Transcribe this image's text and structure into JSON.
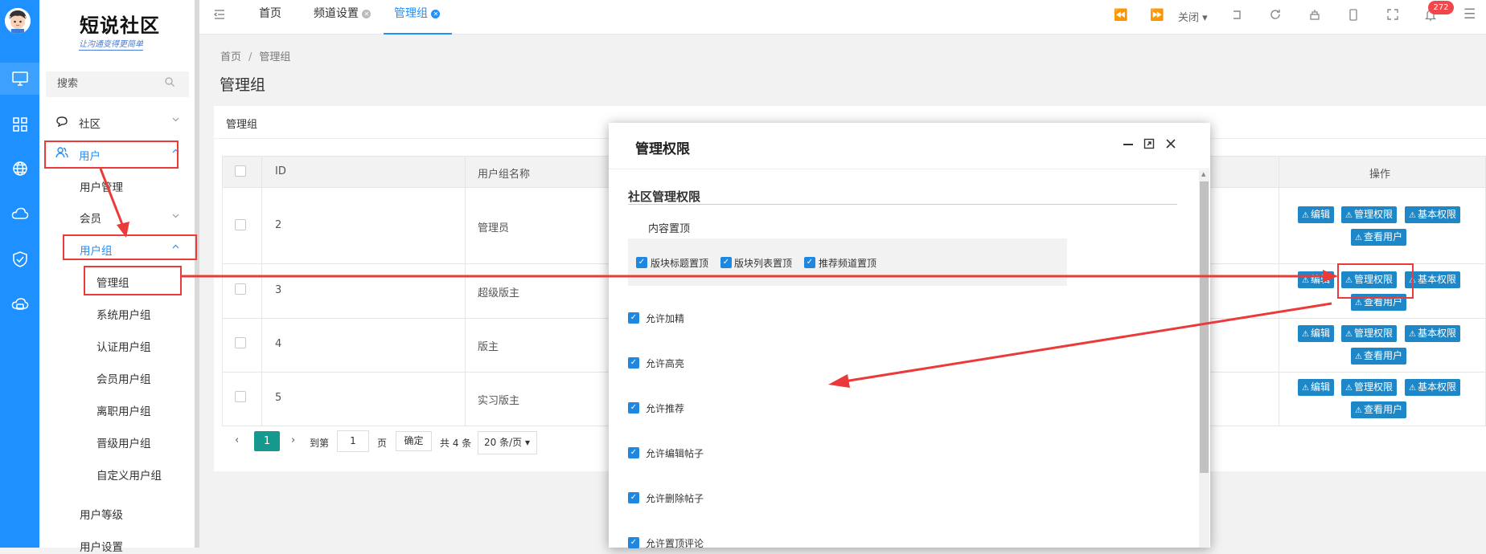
{
  "logo": {
    "title": "短说社区",
    "subtitle": "让沟通变得更简单"
  },
  "search": {
    "placeholder": "搜索"
  },
  "menu": {
    "items": [
      {
        "label": "社区"
      },
      {
        "label": "用户"
      },
      {
        "label": "用户管理"
      },
      {
        "label": "会员"
      },
      {
        "label": "用户组"
      },
      {
        "label": "管理组"
      },
      {
        "label": "系统用户组"
      },
      {
        "label": "认证用户组"
      },
      {
        "label": "会员用户组"
      },
      {
        "label": "离职用户组"
      },
      {
        "label": "晋级用户组"
      },
      {
        "label": "自定义用户组"
      },
      {
        "label": "用户等级"
      },
      {
        "label": "用户设置"
      }
    ]
  },
  "tabs": [
    {
      "label": "首页"
    },
    {
      "label": "频道设置"
    },
    {
      "label": "管理组"
    }
  ],
  "topbar": {
    "close_label": "关闭",
    "notifications": "272"
  },
  "breadcrumb": {
    "home": "首页",
    "sep": "/",
    "current": "管理组"
  },
  "page_title": "管理组",
  "card_title": "管理组",
  "table": {
    "headers": {
      "id": "ID",
      "name": "用户组名称",
      "actions": "操作"
    },
    "rows": [
      {
        "id": "2",
        "name": "管理员"
      },
      {
        "id": "3",
        "name": "超级版主"
      },
      {
        "id": "4",
        "name": "版主"
      },
      {
        "id": "5",
        "name": "实习版主"
      }
    ],
    "action_labels": {
      "edit": "编辑",
      "perm": "管理权限",
      "basic": "基本权限",
      "users": "查看用户"
    }
  },
  "pager": {
    "current": "1",
    "goto": "到第",
    "input_value": "1",
    "page_unit": "页",
    "confirm": "确定",
    "total": "共 4 条",
    "per_page": "20 条/页"
  },
  "modal": {
    "title": "管理权限",
    "section_title": "社区管理权限",
    "subheading": "内容置顶",
    "top_options": [
      "版块标题置顶",
      "版块列表置顶",
      "推荐频道置顶"
    ],
    "options": [
      "允许加精",
      "允许高亮",
      "允许推荐",
      "允许编辑帖子",
      "允许删除帖子",
      "允许置顶评论"
    ]
  },
  "colors": {
    "primary": "#1e90ff",
    "button": "#1e87c8",
    "annotation": "#ea3a3a",
    "badge": "#f2474a"
  }
}
